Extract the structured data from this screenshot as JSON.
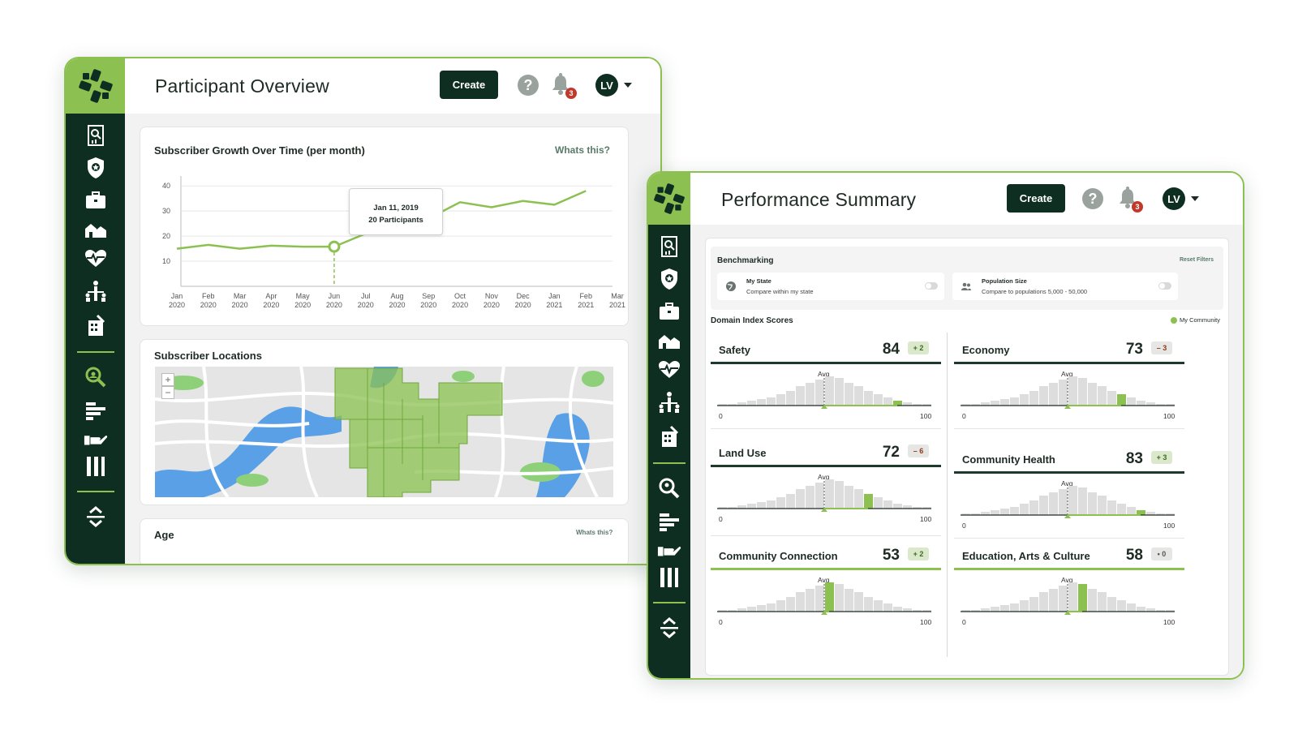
{
  "window1": {
    "title": "Participant Overview",
    "create_label": "Create",
    "help_symbol": "?",
    "notification_count": "3",
    "avatar_initials": "LV",
    "growth_card": {
      "title": "Subscriber Growth Over Time (per month)",
      "whats_this": "Whats this?",
      "tooltip_date": "Jan 11, 2019",
      "tooltip_value": "20 Participants"
    },
    "locations_card": {
      "title": "Subscriber Locations",
      "zoom_in": "+",
      "zoom_out": "−"
    },
    "age_card": {
      "title": "Age",
      "whats_this": "Whats this?"
    }
  },
  "chart_data": {
    "type": "line",
    "title": "Subscriber Growth Over Time (per month)",
    "x": [
      "Jan 2020",
      "Feb 2020",
      "Mar 2020",
      "Apr 2020",
      "May 2020",
      "Jun 2020",
      "Jul 2020",
      "Aug 2020",
      "Sep 2020",
      "Oct 2020",
      "Nov 2020",
      "Dec 2020",
      "Jan 2021",
      "Feb 2021",
      "Mar 2021"
    ],
    "x_tick_labels": [
      [
        "Jan",
        "2020"
      ],
      [
        "Feb",
        "2020"
      ],
      [
        "Mar",
        "2020"
      ],
      [
        "Apr",
        "2020"
      ],
      [
        "May",
        "2020"
      ],
      [
        "Jun",
        "2020"
      ],
      [
        "Jul",
        "2020"
      ],
      [
        "Aug",
        "2020"
      ],
      [
        "Sep",
        "2020"
      ],
      [
        "Oct",
        "2020"
      ],
      [
        "Nov",
        "2020"
      ],
      [
        "Dec",
        "2020"
      ],
      [
        "Jan",
        "2021"
      ],
      [
        "Feb",
        "2021"
      ],
      [
        "Mar",
        "2021"
      ]
    ],
    "y_ticks": [
      10,
      20,
      30,
      40
    ],
    "ylim": [
      0,
      42
    ],
    "series": [
      {
        "values": [
          15,
          16.5,
          15,
          16.2,
          15.8,
          15.8,
          21,
          22,
          27,
          33.5,
          31.5,
          34,
          32.5,
          38,
          null
        ]
      }
    ],
    "highlight_index": 5,
    "grid": true,
    "color": "#8cc152"
  },
  "window2": {
    "title": "Performance Summary",
    "create_label": "Create",
    "help_symbol": "?",
    "notification_count": "3",
    "avatar_initials": "LV",
    "benchmarking": {
      "title": "Benchmarking",
      "reset_label": "Reset Filters",
      "filters": [
        {
          "label": "My State",
          "sub": "Compare within my state",
          "icon": "globe-icon"
        },
        {
          "label": "Population Size",
          "sub": "Compare to populations 5,000 - 50,000",
          "icon": "people-icon"
        }
      ]
    },
    "domain_heading": "Domain Index Scores",
    "legend_label": "My Community",
    "avg_label": "Avg",
    "axis_min": "0",
    "axis_max": "100",
    "domains": [
      {
        "name": "Safety",
        "score": "84",
        "delta": "+ 2",
        "delta_type": "up",
        "value": 84
      },
      {
        "name": "Economy",
        "score": "73",
        "delta": "– 3",
        "delta_type": "down",
        "value": 73
      },
      {
        "name": "Land Use",
        "score": "72",
        "delta": "– 6",
        "delta_type": "down",
        "value": 72
      },
      {
        "name": "Community Health",
        "score": "83",
        "delta": "+ 3",
        "delta_type": "up",
        "value": 83
      },
      {
        "name": "Community Connection",
        "score": "53",
        "delta": "+ 2",
        "delta_type": "up",
        "value": 53
      },
      {
        "name": "Education, Arts & Culture",
        "score": "58",
        "delta": "• 0",
        "delta_type": "flat",
        "value": 58
      }
    ]
  },
  "colors": {
    "brand_green": "#8cc152",
    "dark_green": "#0f2e22",
    "alert_red": "#c0392b"
  }
}
